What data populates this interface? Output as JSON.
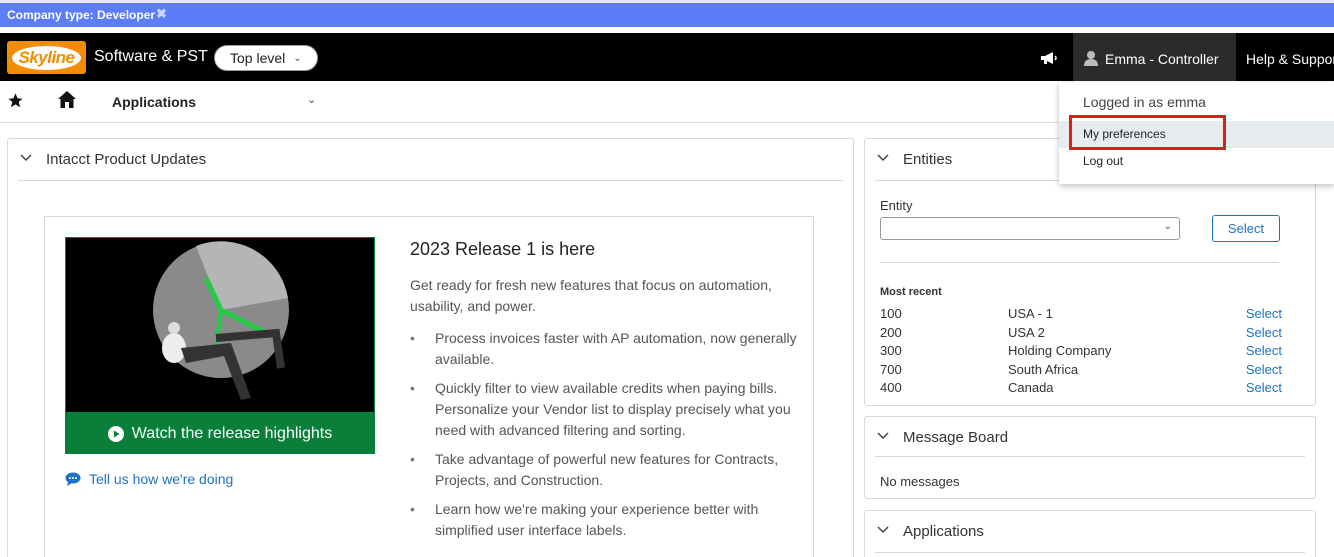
{
  "banner": {
    "company_type": "Company type: Developer",
    "close_symbol": "✖"
  },
  "header": {
    "logo_text": "Skyline",
    "company_name": "Software & PST",
    "level_label": "Top level",
    "user_label": "Emma - Controller",
    "help_label": "Help & Support"
  },
  "nav": {
    "applications_label": "Applications"
  },
  "updates": {
    "title": "Intacct Product Updates",
    "watch_label": "Watch the release highlights",
    "feedback_label": "Tell us how we're doing",
    "release_title": "2023 Release 1 is here",
    "release_intro": "Get ready for fresh new features that focus on automation, usability, and power.",
    "bullets": [
      "Process invoices faster with AP automation, now generally available.",
      "Quickly filter to view available credits when paying bills. Personalize your Vendor list to display precisely what you need with advanced filtering and sorting.",
      "Take advantage of powerful new features for Contracts, Projects, and Construction.",
      "Learn how we're making your experience better with simplified user interface labels."
    ]
  },
  "entities": {
    "title": "Entities",
    "entity_label": "Entity",
    "select_button": "Select",
    "most_recent_label": "Most recent",
    "recent": [
      {
        "id": "100",
        "name": "USA - 1",
        "link": "Select"
      },
      {
        "id": "200",
        "name": "USA 2",
        "link": "Select"
      },
      {
        "id": "300",
        "name": "Holding Company",
        "link": "Select"
      },
      {
        "id": "700",
        "name": "South Africa",
        "link": "Select"
      },
      {
        "id": "400",
        "name": "Canada",
        "link": "Select"
      }
    ]
  },
  "messages": {
    "title": "Message Board",
    "empty_text": "No messages"
  },
  "applications_card": {
    "title": "Applications"
  },
  "user_menu": {
    "logged_in": "Logged in as emma",
    "preferences": "My preferences",
    "logout": "Log out"
  },
  "colors": {
    "banner": "#5c7cfa",
    "accent_green": "#0a7f3a",
    "link_blue": "#1a73c8",
    "highlight_red": "#e01b1b"
  }
}
